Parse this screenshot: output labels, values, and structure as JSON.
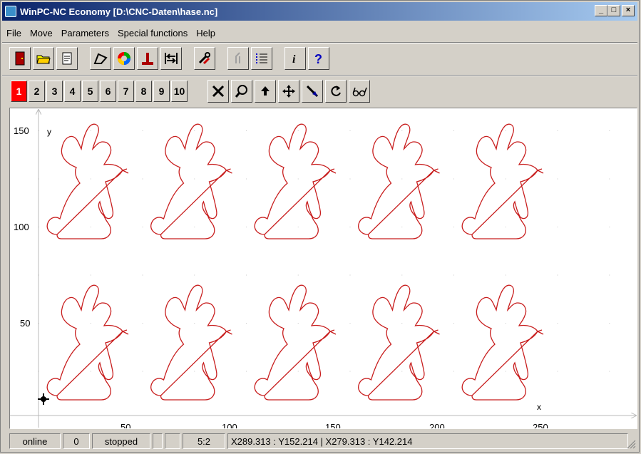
{
  "window": {
    "title": "WinPC-NC Economy [D:\\CNC-Daten\\hase.nc]"
  },
  "window_buttons": {
    "minimize": "_",
    "maximize": "□",
    "close": "×"
  },
  "menu": [
    {
      "label": "File"
    },
    {
      "label": "Move"
    },
    {
      "label": "Parameters"
    },
    {
      "label": "Special functions"
    },
    {
      "label": "Help"
    }
  ],
  "toolbar1": [
    {
      "icon": "exit-door-icon"
    },
    {
      "icon": "open-folder-icon"
    },
    {
      "icon": "document-icon"
    },
    {
      "icon": "vector-path-icon"
    },
    {
      "icon": "color-wheel-icon"
    },
    {
      "icon": "tool-position-icon"
    },
    {
      "icon": "reference-run-icon"
    },
    {
      "icon": "wrench-tools-icon"
    },
    {
      "icon": "tool-change-icon"
    },
    {
      "icon": "list-icon"
    },
    {
      "icon": "info-icon"
    },
    {
      "icon": "help-icon"
    }
  ],
  "toolbar2_numbers": [
    "1",
    "2",
    "3",
    "4",
    "5",
    "6",
    "7",
    "8",
    "9",
    "10"
  ],
  "toolbar2_active": "1",
  "toolbar2_tools": [
    {
      "icon": "clear-x-icon"
    },
    {
      "icon": "zoom-icon"
    },
    {
      "icon": "up-arrow-icon"
    },
    {
      "icon": "pan-move-icon"
    },
    {
      "icon": "pointer-icon"
    },
    {
      "icon": "redraw-icon"
    },
    {
      "icon": "glasses-icon"
    }
  ],
  "plot": {
    "x_axis_label": "x",
    "y_axis_label": "y",
    "x_ticks": [
      "50",
      "100",
      "150",
      "200",
      "250"
    ],
    "y_ticks": [
      "150",
      "100",
      "50"
    ],
    "shape_color": "#c81e1e",
    "grid_rows": 2,
    "grid_cols": 5
  },
  "status": {
    "connection": "online",
    "count": "0",
    "state": "stopped",
    "blank1": "",
    "blank2": "",
    "ratio": "5:2",
    "coords": "X289.313 : Y152.214  |  X279.313 : Y142.214"
  }
}
